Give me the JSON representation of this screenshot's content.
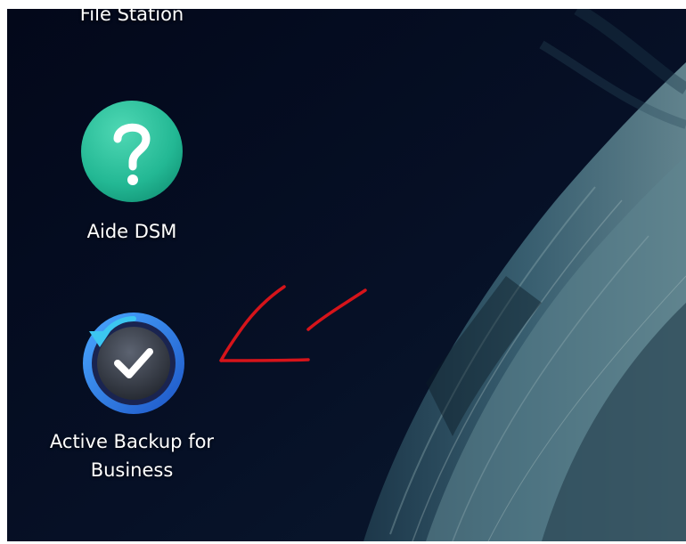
{
  "desktop": {
    "icons": [
      {
        "label": "File Station",
        "icon": "file-station-icon"
      },
      {
        "label": "Aide DSM",
        "icon": "help-question-icon"
      },
      {
        "label": "Active Backup for\nBusiness",
        "icon": "active-backup-icon"
      }
    ]
  },
  "annotation": {
    "type": "hand-drawn-arrow",
    "color": "#d6141a"
  },
  "colors": {
    "desktop_background": "#050b1c",
    "help_icon_green": "#23b894",
    "backup_ring_blue": "#2a7fe0",
    "backup_arrow_cyan": "#3cc6f0"
  }
}
